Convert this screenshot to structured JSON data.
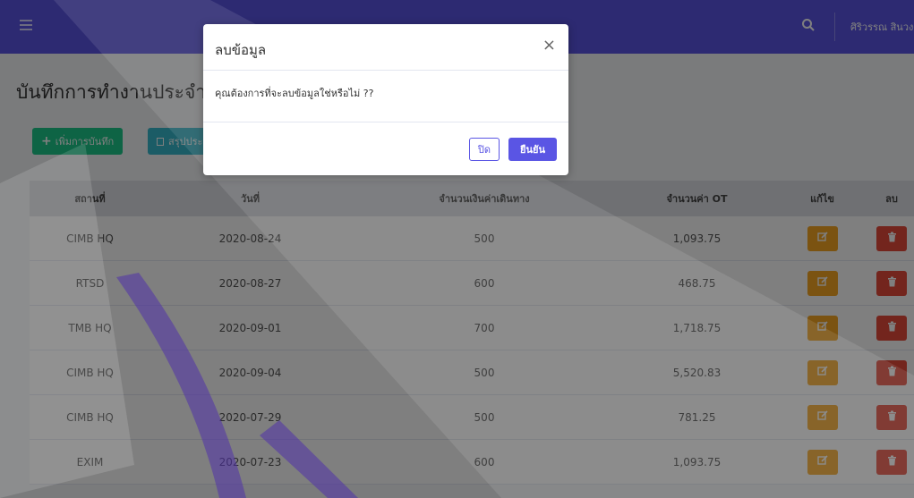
{
  "navbar": {
    "user_name": "ศิริวรรณ สินวงศ์"
  },
  "page": {
    "title": "บันทึกการทำงานประจำวัน",
    "add_label": "เพิ่มการบันทึก",
    "summary_label": "สรุปประจำ"
  },
  "table": {
    "headers": [
      "สถานที่",
      "วันที่",
      "จำนวนเงินค่าเดินทาง",
      "จำนวนค่า OT",
      "แก้ไข",
      "ลบ"
    ],
    "rows": [
      {
        "location": "CIMB HQ",
        "date": "2020-08-24",
        "travel": "500",
        "ot": "1,093.75"
      },
      {
        "location": "RTSD",
        "date": "2020-08-27",
        "travel": "600",
        "ot": "468.75"
      },
      {
        "location": "TMB HQ",
        "date": "2020-09-01",
        "travel": "700",
        "ot": "1,718.75"
      },
      {
        "location": "CIMB HQ",
        "date": "2020-09-04",
        "travel": "500",
        "ot": "5,520.83"
      },
      {
        "location": "CIMB HQ",
        "date": "2020-07-29",
        "travel": "500",
        "ot": "781.25"
      },
      {
        "location": "EXIM",
        "date": "2020-07-23",
        "travel": "600",
        "ot": "1,093.75"
      }
    ]
  },
  "modal": {
    "title": "ลบข้อมูล",
    "close_symbol": "×",
    "message": "คุณต้องการที่จะลบข้อมูลใช่หรือไม่ ??",
    "close_label": "ปิด",
    "confirm_label": "ยืนยัน"
  },
  "colors": {
    "primary": "#5a55e4",
    "success": "#1cc88a",
    "info": "#36b9cc",
    "warning": "#f6a623",
    "danger": "#e74a3b"
  },
  "icons": [
    "hamburger-icon",
    "search-icon",
    "plus-icon",
    "copy-icon",
    "edit-icon",
    "trash-icon",
    "close-icon"
  ]
}
